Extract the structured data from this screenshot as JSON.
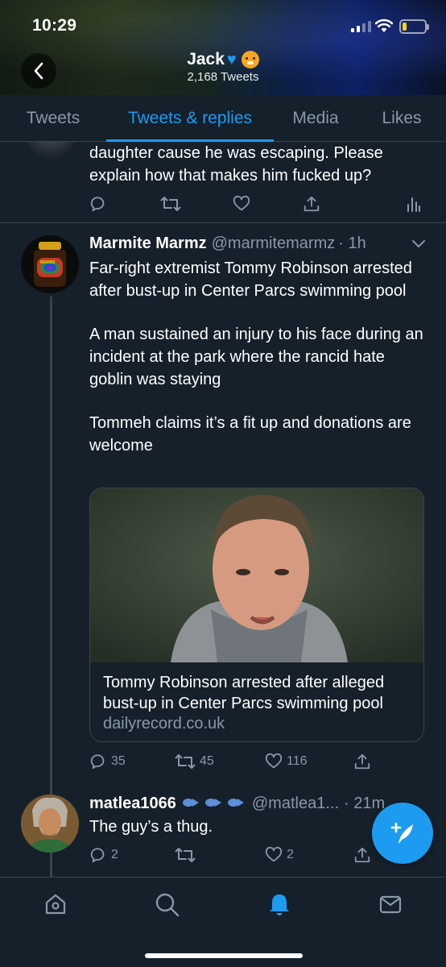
{
  "status_bar": {
    "time": "10:29"
  },
  "profile": {
    "name": "Jack",
    "tweet_count": "2,168 Tweets"
  },
  "tabs": [
    {
      "label": "Tweets"
    },
    {
      "label": "Tweets & replies"
    },
    {
      "label": "Media"
    },
    {
      "label": "Likes"
    }
  ],
  "active_tab": "Tweets & replies",
  "prev_tweet": {
    "text": "daughter cause he was escaping. Please explain how that makes him fucked up?"
  },
  "tweet": {
    "name": "Marmite Marmz",
    "handle": "@marmitemarmz",
    "time": "· 1h",
    "avatar_label": "MARMZ",
    "paragraphs": [
      "Far-right extremist Tommy Robinson arrested after bust-up in Center Parcs swimming pool",
      "A man sustained an injury to his face during an incident at the park where the rancid hate goblin was staying",
      "Tommeh claims it’s a fit up and donations are welcome"
    ],
    "card": {
      "title": "Tommy Robinson arrested after alleged bust-up in Center Parcs swimming pool",
      "domain": "dailyrecord.co.uk"
    },
    "replies": "35",
    "retweets": "45",
    "likes": "116"
  },
  "reply": {
    "name": "matlea1066",
    "handle": "@matlea1...",
    "time": "· 21m",
    "text": "The guy’s a thug.",
    "replies": "2",
    "likes": "2"
  },
  "colors": {
    "background": "#15202b",
    "accent": "#1d9bf0",
    "secondary_text": "#8899a6",
    "border": "#38444d"
  },
  "icons": {
    "reply": "reply-icon",
    "retweet": "retweet-icon",
    "like": "heart-icon",
    "share": "share-icon",
    "analytics": "analytics-icon",
    "compose": "compose-tweet-icon",
    "nav": [
      "home-icon",
      "search-icon",
      "notifications-icon",
      "messages-icon"
    ]
  }
}
